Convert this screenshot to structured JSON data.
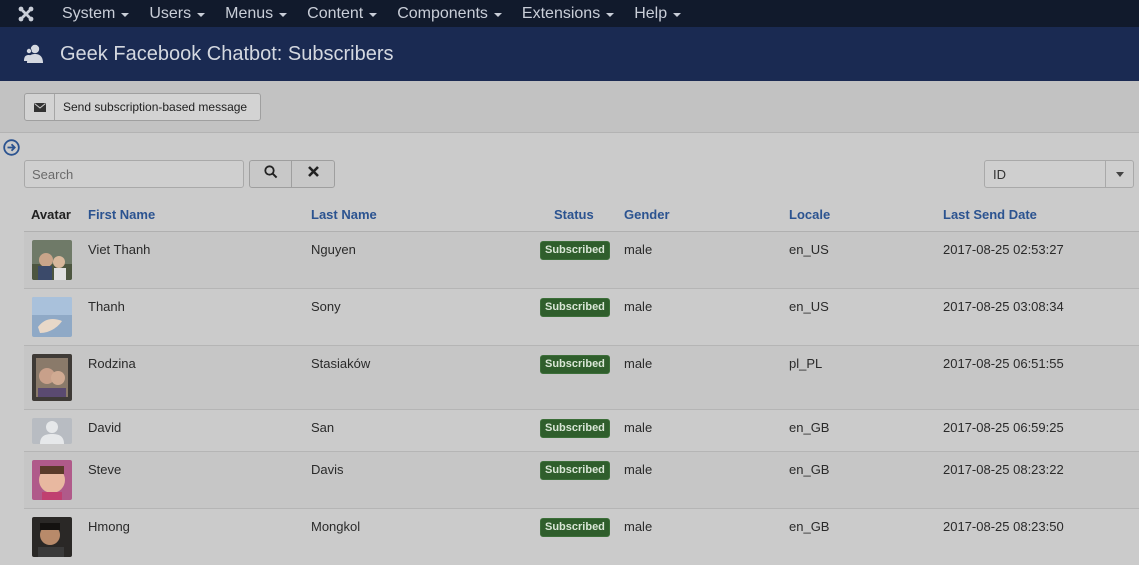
{
  "nav": {
    "logo_icon": "joomla-logo-icon",
    "menu": [
      {
        "label": "System"
      },
      {
        "label": "Users"
      },
      {
        "label": "Menus"
      },
      {
        "label": "Content"
      },
      {
        "label": "Components"
      },
      {
        "label": "Extensions"
      },
      {
        "label": "Help"
      }
    ]
  },
  "header": {
    "icon": "users-icon",
    "title": "Geek Facebook Chatbot: Subscribers"
  },
  "toolbar": {
    "send_icon": "envelope-icon",
    "send_label": "Send subscription-based message"
  },
  "filters": {
    "search_placeholder": "Search",
    "search_value": "",
    "sort_selected": "ID"
  },
  "table": {
    "headers": {
      "avatar": "Avatar",
      "first_name": "First Name",
      "last_name": "Last Name",
      "status": "Status",
      "gender": "Gender",
      "locale": "Locale",
      "last_send_date": "Last Send Date"
    },
    "rows": [
      {
        "first_name": "Viet Thanh",
        "last_name": "Nguyen",
        "status": "Subscribed",
        "gender": "male",
        "locale": "en_US",
        "last_send_date": "2017-08-25 02:53:27"
      },
      {
        "first_name": "Thanh",
        "last_name": "Sony",
        "status": "Subscribed",
        "gender": "male",
        "locale": "en_US",
        "last_send_date": "2017-08-25 03:08:34"
      },
      {
        "first_name": "Rodzina",
        "last_name": "Stasiaków",
        "status": "Subscribed",
        "gender": "male",
        "locale": "pl_PL",
        "last_send_date": "2017-08-25 06:51:55"
      },
      {
        "first_name": "David",
        "last_name": "San",
        "status": "Subscribed",
        "gender": "male",
        "locale": "en_GB",
        "last_send_date": "2017-08-25 06:59:25"
      },
      {
        "first_name": "Steve",
        "last_name": "Davis",
        "status": "Subscribed",
        "gender": "male",
        "locale": "en_GB",
        "last_send_date": "2017-08-25 08:23:22"
      },
      {
        "first_name": "Hmong",
        "last_name": "Mongkol",
        "status": "Subscribed",
        "gender": "male",
        "locale": "en_GB",
        "last_send_date": "2017-08-25 08:23:50"
      }
    ]
  },
  "colors": {
    "navbar": "#111a2c",
    "header": "#1a2a52",
    "link": "#2b5390",
    "subscribed_badge": "#2f5e2c"
  }
}
